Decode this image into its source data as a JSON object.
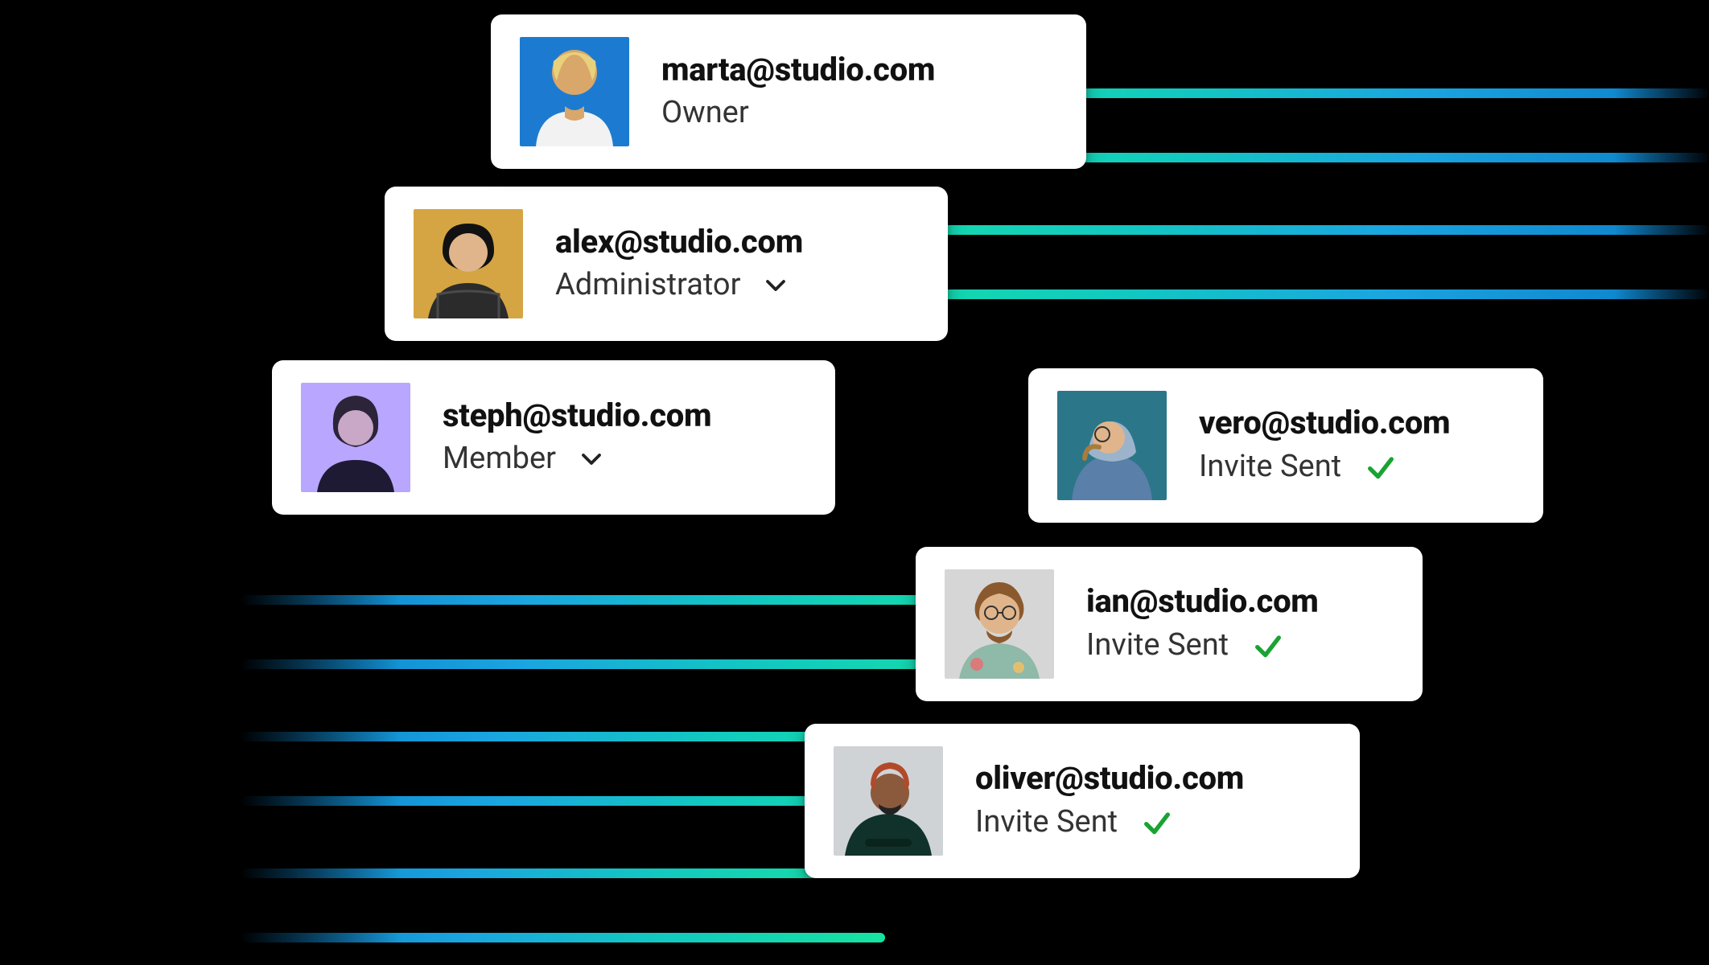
{
  "members": [
    {
      "email": "marta@studio.com",
      "role": "Owner",
      "has_dropdown": false,
      "invite_sent": false
    },
    {
      "email": "alex@studio.com",
      "role": "Administrator",
      "has_dropdown": true,
      "invite_sent": false
    },
    {
      "email": "steph@studio.com",
      "role": "Member",
      "has_dropdown": true,
      "invite_sent": false
    },
    {
      "email": "vero@studio.com",
      "role": "Invite Sent",
      "has_dropdown": false,
      "invite_sent": true
    },
    {
      "email": "ian@studio.com",
      "role": "Invite Sent",
      "has_dropdown": false,
      "invite_sent": true
    },
    {
      "email": "oliver@studio.com",
      "role": "Invite Sent",
      "has_dropdown": false,
      "invite_sent": true
    }
  ],
  "icons": {
    "chevron_down": "chevron-down",
    "check": "check"
  },
  "colors": {
    "check_green": "#1aa333"
  }
}
